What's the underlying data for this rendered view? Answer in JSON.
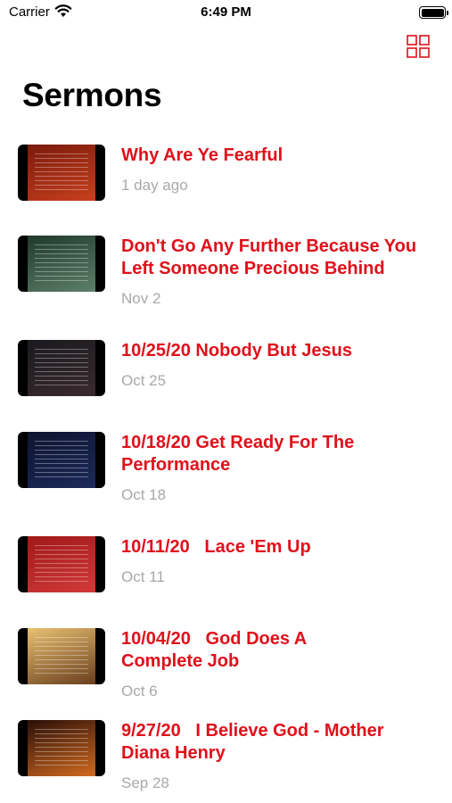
{
  "status_bar": {
    "carrier": "Carrier",
    "time": "6:49 PM",
    "wifi_icon": "wifi-icon",
    "battery_icon": "battery-icon"
  },
  "nav": {
    "grid_icon": "grid-view-icon",
    "accent_color": "#e0101a"
  },
  "page_title": "Sermons",
  "sermons": [
    {
      "title_lines": [
        "Why Are Ye Fearful"
      ],
      "date": "1 day ago",
      "thumb_colors": [
        "#7a1a0c",
        "#c8401e"
      ]
    },
    {
      "title_lines": [
        "Don't Go Any Further Because You",
        "Left Someone Precious Behind"
      ],
      "date": "Nov 2",
      "thumb_colors": [
        "#1f3a2a",
        "#5d7f6a"
      ]
    },
    {
      "title_lines": [
        "10/25/20 Nobody But Jesus"
      ],
      "date": "Oct 25",
      "thumb_colors": [
        "#1a1a1e",
        "#3a2a2e"
      ]
    },
    {
      "title_lines": [
        "10/18/20 Get Ready For The",
        "Performance"
      ],
      "date": "Oct 18",
      "thumb_colors": [
        "#0d1430",
        "#1c2a5a"
      ]
    },
    {
      "title_lines": [
        "10/11/20   Lace 'Em Up"
      ],
      "date": "Oct 11",
      "thumb_colors": [
        "#a01818",
        "#d23a3a"
      ]
    },
    {
      "title_lines": [
        "10/04/20   God Does A",
        "Complete Job"
      ],
      "date": "Oct 6",
      "thumb_colors": [
        "#e8c070",
        "#6a3e1e"
      ]
    },
    {
      "title_lines": [
        "9/27/20   I Believe God - Mother",
        "Diana Henry"
      ],
      "date": "Sep 28",
      "thumb_colors": [
        "#2a0f08",
        "#d06a20"
      ]
    }
  ]
}
